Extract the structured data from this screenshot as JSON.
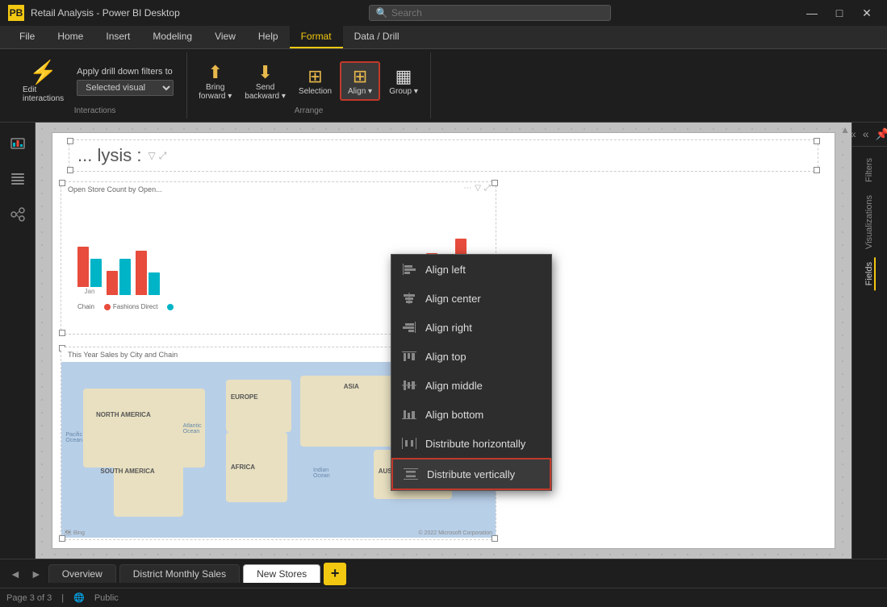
{
  "title_bar": {
    "app_name": "Retail Analysis - Power BI Desktop",
    "search_placeholder": "Search",
    "btn_minimize": "—",
    "btn_maximize": "□",
    "btn_close": "✕"
  },
  "ribbon": {
    "tabs": [
      "File",
      "Home",
      "Insert",
      "Modeling",
      "View",
      "Help",
      "Format",
      "Data / Drill"
    ],
    "active_tab": "Format",
    "groups": {
      "interactions": {
        "label": "Interactions",
        "edit_interactions_label": "Edit\ninteractions",
        "drill_filters_label": "Apply drill down filters to",
        "drill_filters_select": "Selected visual"
      },
      "arrange": {
        "label": "Arrange",
        "bring_forward_label": "Bring\nforward",
        "send_backward_label": "Send\nbackward",
        "selection_label": "Selection",
        "align_label": "Align",
        "group_label": "Group"
      }
    }
  },
  "align_dropdown": {
    "items": [
      {
        "id": "align-left",
        "label": "Align left",
        "icon": "⊣"
      },
      {
        "id": "align-center",
        "label": "Align center",
        "icon": "≡"
      },
      {
        "id": "align-right",
        "label": "Align right",
        "icon": "⊢"
      },
      {
        "id": "align-top",
        "label": "Align top",
        "icon": "⊤"
      },
      {
        "id": "align-middle",
        "label": "Align middle",
        "icon": "⋯"
      },
      {
        "id": "align-bottom",
        "label": "Align bottom",
        "icon": "⊥"
      },
      {
        "id": "distribute-horizontally",
        "label": "Distribute horizontally",
        "icon": "⟺"
      },
      {
        "id": "distribute-vertically",
        "label": "Distribute vertically",
        "icon": "⟸",
        "highlighted": true
      }
    ]
  },
  "canvas": {
    "report_title": "Retail Analysis",
    "chart1_title": "Open Store Count by Open...",
    "chart1_legend_items": [
      {
        "label": "Fashions Direct",
        "color": "#00b4c8"
      },
      {
        "label": "Chain",
        "color": "#e74c3c"
      }
    ],
    "map_title": "This Year Sales by City and Chain",
    "map_regions": [
      "NORTH AMERICA",
      "EUROPE",
      "ASIA",
      "AFRICA",
      "SOUTH AMERICA",
      "AUSTRALIA"
    ],
    "map_labels": [
      "Pacific\nOcean",
      "Atlantic\nOcean",
      "Indian\nOcean"
    ],
    "map_credit": "© 2022 Microsoft Corporation"
  },
  "right_panel": {
    "filters_label": "Filters",
    "visualizations_label": "Visualizations",
    "fields_label": "Fields"
  },
  "bottom_tabs": {
    "pages": [
      "Overview",
      "District Monthly Sales",
      "New Stores"
    ],
    "active_page": "New Stores"
  },
  "status_bar": {
    "page_info": "Page 3 of 3",
    "visibility": "Public"
  },
  "section_labels": {
    "interactions_label": "Interactions",
    "arrange_label": "Arrange"
  }
}
